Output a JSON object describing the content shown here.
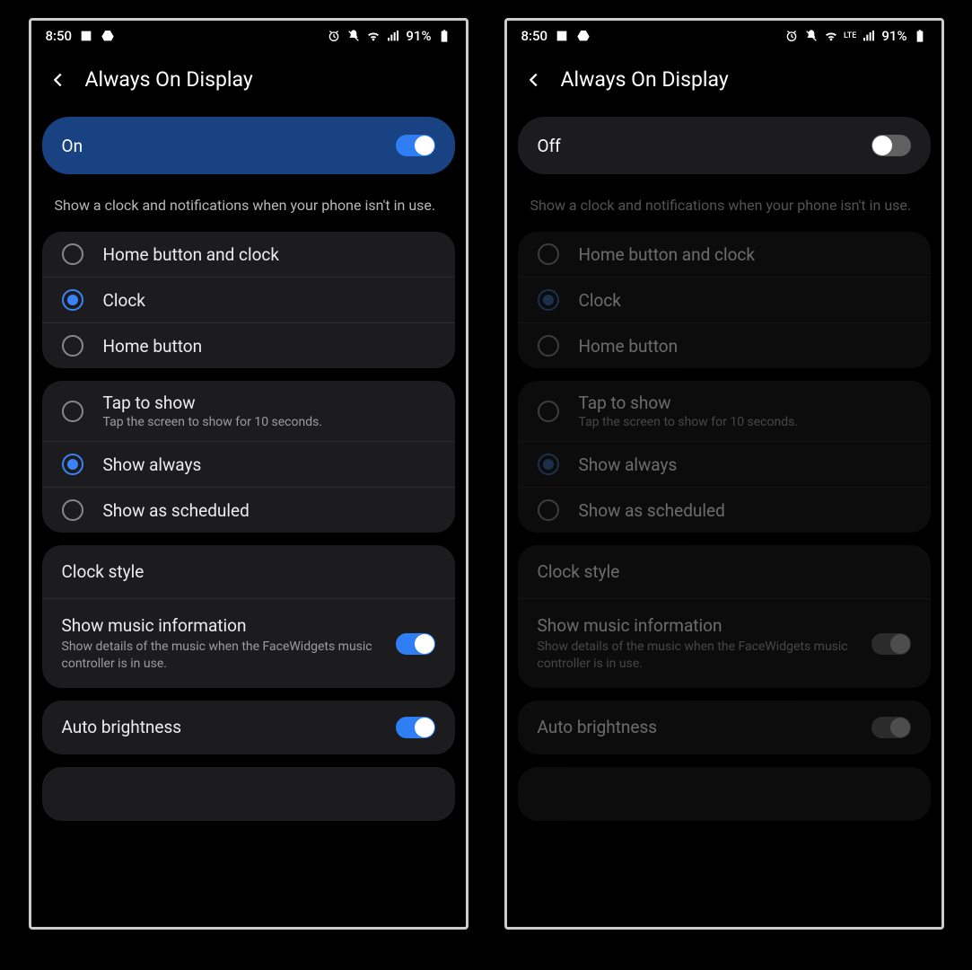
{
  "status": {
    "time": "8:50",
    "battery": "91%",
    "lte_label": "LTE"
  },
  "header": {
    "title": "Always On Display"
  },
  "left": {
    "master_label": "On"
  },
  "right": {
    "master_label": "Off"
  },
  "desc": "Show a clock and notifications when your phone isn't in use.",
  "group1": {
    "opt0": "Home button and clock",
    "opt1": "Clock",
    "opt2": "Home button"
  },
  "group2": {
    "opt0": "Tap to show",
    "opt0_sub": "Tap the screen to show for 10 seconds.",
    "opt1": "Show always",
    "opt2": "Show as scheduled"
  },
  "settings": {
    "clock_style": "Clock style",
    "music_label": "Show music information",
    "music_sub": "Show details of the music when the FaceWidgets music controller is in use.",
    "auto_brightness": "Auto brightness"
  }
}
